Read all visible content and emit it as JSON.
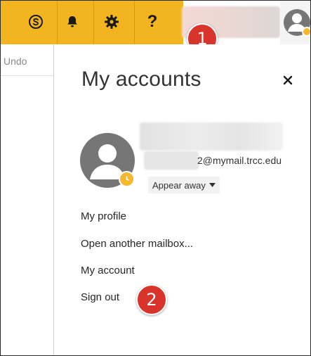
{
  "header": {
    "icons": [
      "skype-icon",
      "bell-icon",
      "gear-icon",
      "help-icon",
      "avatar-icon"
    ],
    "help_label": "?"
  },
  "left": {
    "undo_label": "Undo"
  },
  "panel": {
    "title": "My accounts",
    "close_label": "×",
    "email": "2@mymail.trcc.edu",
    "presence_label": "Appear away",
    "presence_color": "#f5b82e",
    "menu": [
      {
        "label": "My profile"
      },
      {
        "label": "Open another mailbox..."
      },
      {
        "label": "My account"
      },
      {
        "label": "Sign out"
      }
    ]
  },
  "callouts": [
    "1",
    "2"
  ],
  "colors": {
    "topbar": "#f3b51f",
    "callout": "#d9342b",
    "avatar": "#767676"
  }
}
